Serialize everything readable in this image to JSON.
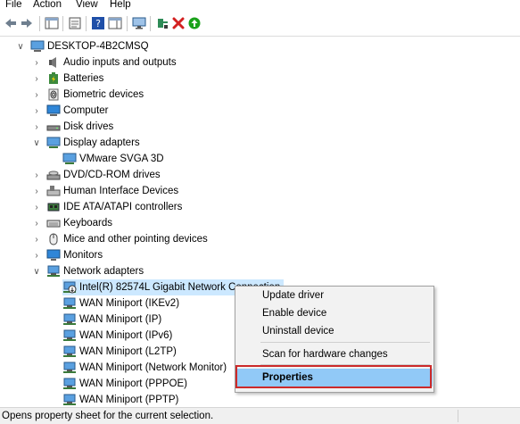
{
  "menu": [
    "File",
    "Action",
    "View",
    "Help"
  ],
  "toolbar": {
    "buttons": [
      "back-arrow-icon",
      "forward-arrow-icon",
      "console-tree-icon",
      "properties-icon",
      "help-icon",
      "action-pane-icon",
      "monitor-icon",
      "update-driver-icon",
      "uninstall-x-icon",
      "enable-device-icon"
    ],
    "colors": {
      "update_driver": "#2e8b57",
      "uninstall": "#d32020",
      "enable": "#1aa11a",
      "help": "#1f4fa8"
    }
  },
  "tree": {
    "root": "DESKTOP-4B2CMSQ",
    "categories": {
      "audio": "Audio inputs and outputs",
      "batteries": "Batteries",
      "biometric": "Biometric devices",
      "computer": "Computer",
      "disk": "Disk drives",
      "display": "Display adapters",
      "dvd": "DVD/CD-ROM drives",
      "hid": "Human Interface Devices",
      "ide": "IDE ATA/ATAPI controllers",
      "keyboards": "Keyboards",
      "mice": "Mice and other pointing devices",
      "monitors": "Monitors",
      "network": "Network adapters"
    },
    "display_children": [
      "VMware SVGA 3D"
    ],
    "network_children": [
      "Intel(R) 82574L Gigabit Network Connection",
      "WAN Miniport (IKEv2)",
      "WAN Miniport (IP)",
      "WAN Miniport (IPv6)",
      "WAN Miniport (L2TP)",
      "WAN Miniport (Network Monitor)",
      "WAN Miniport (PPPOE)",
      "WAN Miniport (PPTP)"
    ]
  },
  "context_menu": {
    "update_driver": "Update driver",
    "enable_device": "Enable device",
    "uninstall_device": "Uninstall device",
    "scan": "Scan for hardware changes",
    "properties": "Properties"
  },
  "status": "Opens property sheet for the current selection."
}
